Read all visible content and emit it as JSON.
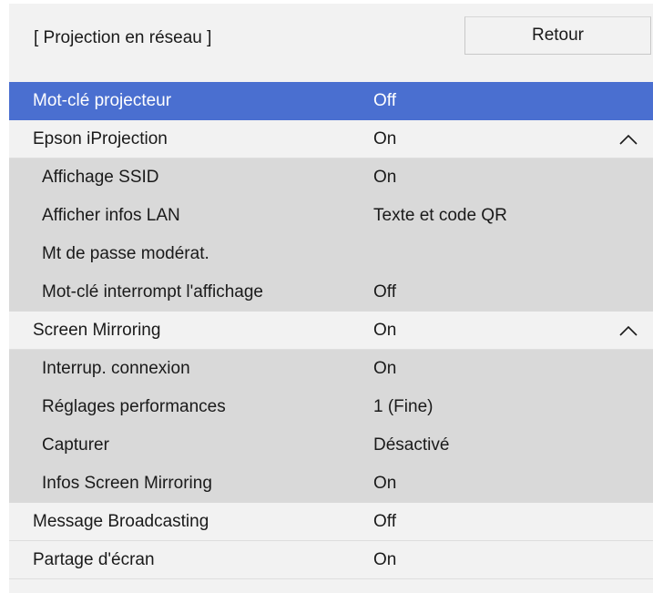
{
  "header": {
    "title": "[ Projection en réseau ]",
    "back_label": "Retour"
  },
  "colors": {
    "selected": "#4a6fd0",
    "panel": "#f2f2f2",
    "subsection": "#d9d9d9"
  },
  "menu": {
    "items": [
      {
        "label": "Mot-clé projecteur",
        "value": "Off"
      },
      {
        "label": "Epson iProjection",
        "value": "On",
        "icon": "chevron-up-icon"
      },
      {
        "label": "Affichage SSID",
        "value": "On"
      },
      {
        "label": "Afficher infos LAN",
        "value": "Texte et code QR"
      },
      {
        "label": "Mt de passe modérat.",
        "value": ""
      },
      {
        "label": "Mot-clé interrompt l'affichage",
        "value": "Off"
      },
      {
        "label": "Screen Mirroring",
        "value": "On",
        "icon": "chevron-up-icon"
      },
      {
        "label": "Interrup. connexion",
        "value": "On"
      },
      {
        "label": "Réglages performances",
        "value": "1 (Fine)"
      },
      {
        "label": "Capturer",
        "value": "Désactivé"
      },
      {
        "label": "Infos Screen Mirroring",
        "value": "On"
      },
      {
        "label": "Message Broadcasting",
        "value": "Off"
      },
      {
        "label": "Partage d'écran",
        "value": "On"
      }
    ]
  }
}
